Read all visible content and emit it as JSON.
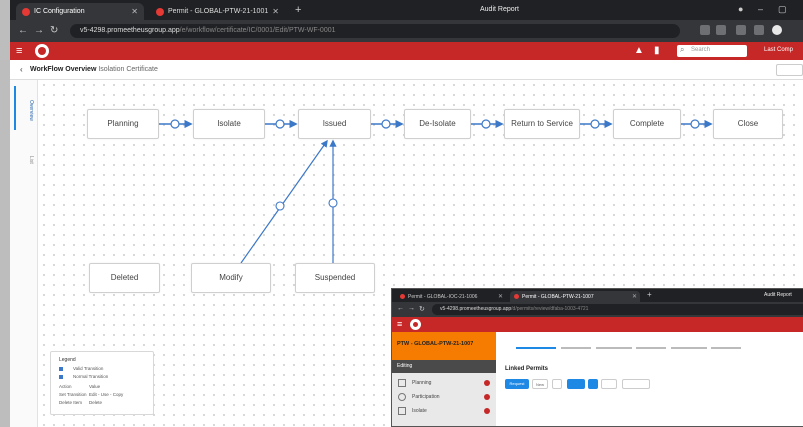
{
  "browser": {
    "tabs": [
      {
        "label": "IC Configuration"
      },
      {
        "label": "Permit - GLOBAL-PTW-21-1001"
      }
    ],
    "window_title": "Audit Report",
    "url": "v5-4298.promeetheusgroup.app",
    "url_path": "/e/workflow/certificate/IC/0001/Edit/PTW-WF-0001"
  },
  "app_header": {
    "search_placeholder": "Search",
    "user_label": "Last Comp"
  },
  "page": {
    "breadcrumb_strong": "WorkFlow Overview",
    "breadcrumb_rest": "Isolation Certificate",
    "side_tabs": [
      "Overview",
      "List"
    ]
  },
  "workflow": {
    "nodes": [
      {
        "label": "Planning"
      },
      {
        "label": "Isolate"
      },
      {
        "label": "Issued"
      },
      {
        "label": "De-Isolate"
      },
      {
        "label": "Return to Service"
      },
      {
        "label": "Complete"
      },
      {
        "label": "Close"
      },
      {
        "label": "Deleted"
      },
      {
        "label": "Modify"
      },
      {
        "label": "Suspended"
      }
    ]
  },
  "legend": {
    "title": "Legend",
    "rows": [
      {
        "label": "Valid Transition"
      },
      {
        "label": "Normal Transition"
      }
    ],
    "table_rows": [
      {
        "a": "Action",
        "b": "Value"
      },
      {
        "a": "Set Transition",
        "b": "Edit - Use - Copy"
      },
      {
        "a": "Delete Item",
        "b": "Delete"
      }
    ]
  },
  "overlay": {
    "tabs": [
      {
        "label": "Permit - GLOBAL-IOC-21-1006"
      },
      {
        "label": "Permit - GLOBAL-PTW-21-1007"
      }
    ],
    "window_title": "Audit Report",
    "url": "v5-4298.promeetheusgroup.app",
    "url_path": "/d/permits/review/dfaba-1003-4721",
    "permit_id": "PTW - GLOBAL-PTW-21-1007",
    "section": "Editing",
    "side_items": [
      {
        "label": "Planning"
      },
      {
        "label": "Participation"
      },
      {
        "label": "Isolate"
      }
    ],
    "linked_permits": "Linked Permits",
    "buttons": [
      "Request",
      "New"
    ]
  }
}
